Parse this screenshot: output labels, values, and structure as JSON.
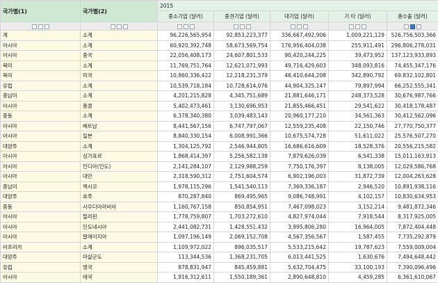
{
  "header": {
    "col1": "국가별(1)",
    "col2": "국가별(2)",
    "year": "2015",
    "metrics": [
      "중소기업 (달러)",
      "중견기업 (달러)",
      "대기업 (달러)",
      "기 타 (달러)",
      "총수출 (달러)"
    ]
  },
  "rows": [
    [
      "계",
      "소계",
      "96,226,565,954",
      "92,853,223,377",
      "336,667,492,906",
      "1,009,221,129",
      "526,756,503,366"
    ],
    [
      "아시아",
      "소계",
      "60,920,392,748",
      "58,673,569,754",
      "176,956,404,038",
      "255,911,491",
      "296,806,278,031"
    ],
    [
      "아시아",
      "중국",
      "22,056,408,173",
      "24,607,801,533",
      "90,420,244,225",
      "39,473,952",
      "137,123,933,893"
    ],
    [
      "북미",
      "소계",
      "11,769,751,764",
      "12,621,071,993",
      "49,716,429,603",
      "348,093,816",
      "74,455,347,176"
    ],
    [
      "북미",
      "미국",
      "10,860,336,422",
      "12,218,231,379",
      "46,410,644,208",
      "342,890,792",
      "69,832,102,801"
    ],
    [
      "유럽",
      "소계",
      "10,539,718,184",
      "10,728,614,076",
      "44,904,325,147",
      "79,897,994",
      "66,252,555,341"
    ],
    [
      "중남미",
      "소계",
      "4,201,215,828",
      "4,345,751,689",
      "21,881,646,171",
      "248,373,528",
      "30,676,987,766"
    ],
    [
      "아시아",
      "홍콩",
      "5,402,473,461",
      "3,130,696,953",
      "21,855,466,451",
      "29,541,622",
      "30,418,178,487"
    ],
    [
      "중동",
      "소계",
      "6,378,340,380",
      "3,039,483,143",
      "20,960,177,210",
      "34,561,363",
      "30,412,562,096"
    ],
    [
      "아시아",
      "베트남",
      "8,441,567,156",
      "6,747,797,067",
      "12,559,235,408",
      "22,150,746",
      "27,770,750,377"
    ],
    [
      "아시아",
      "일본",
      "8,840,330,154",
      "6,008,991,366",
      "10,675,574,728",
      "51,611,022",
      "25,576,507,270"
    ],
    [
      "대양주",
      "소계",
      "1,304,125,792",
      "2,546,944,805",
      "16,686,616,609",
      "18,528,376",
      "20,556,215,582"
    ],
    [
      "아시아",
      "싱가포르",
      "1,868,414,397",
      "5,256,582,139",
      "7,879,626,039",
      "6,541,338",
      "15,011,163,913"
    ],
    [
      "아시아",
      "인디아(인도)",
      "2,141,284,107",
      "2,129,988,259",
      "7,750,176,397",
      "8,138,005",
      "12,029,586,768"
    ],
    [
      "아시아",
      "대만",
      "2,318,590,312",
      "2,751,604,574",
      "6,902,196,003",
      "31,872,739",
      "12,004,263,628"
    ],
    [
      "중남미",
      "멕시코",
      "1,978,115,296",
      "1,541,540,113",
      "7,369,336,187",
      "2,946,520",
      "10,891,938,116"
    ],
    [
      "대양주",
      "호주",
      "870,287,840",
      "869,495,965",
      "9,086,748,991",
      "4,102,157",
      "10,830,634,953"
    ],
    [
      "중동",
      "사우디아라비아",
      "1,160,767,158",
      "850,854,951",
      "7,467,098,023",
      "3,152,214",
      "9,481,872,346"
    ],
    [
      "아시아",
      "필리핀",
      "1,778,759,807",
      "1,703,272,610",
      "4,827,974,044",
      "7,918,544",
      "8,317,925,005"
    ],
    [
      "아시아",
      "인도네시아",
      "2,441,082,731",
      "1,428,551,432",
      "3,995,806,280",
      "16,964,005",
      "7,872,404,448"
    ],
    [
      "아시아",
      "말레이지아",
      "1,097,196,149",
      "2,069,152,708",
      "4,567,356,567",
      "1,587,455",
      "7,735,292,879"
    ],
    [
      "아프리카",
      "소계",
      "1,109,972,022",
      "896,035,517",
      "5,533,215,642",
      "19,787,623",
      "7,559,009,004"
    ],
    [
      "대양주",
      "마샬군도",
      "113,344,536",
      "1,368,231,705",
      "6,013,441,525",
      "1,630,676",
      "7,494,648,442"
    ],
    [
      "유럽",
      "영국",
      "878,831,947",
      "845,459,881",
      "5,632,704,475",
      "33,100,193",
      "7,390,096,496"
    ],
    [
      "아시아",
      "태국",
      "1,916,312,611",
      "1,550,189,361",
      "2,890,648,810",
      "4,459,285",
      "6,361,610,067"
    ]
  ]
}
